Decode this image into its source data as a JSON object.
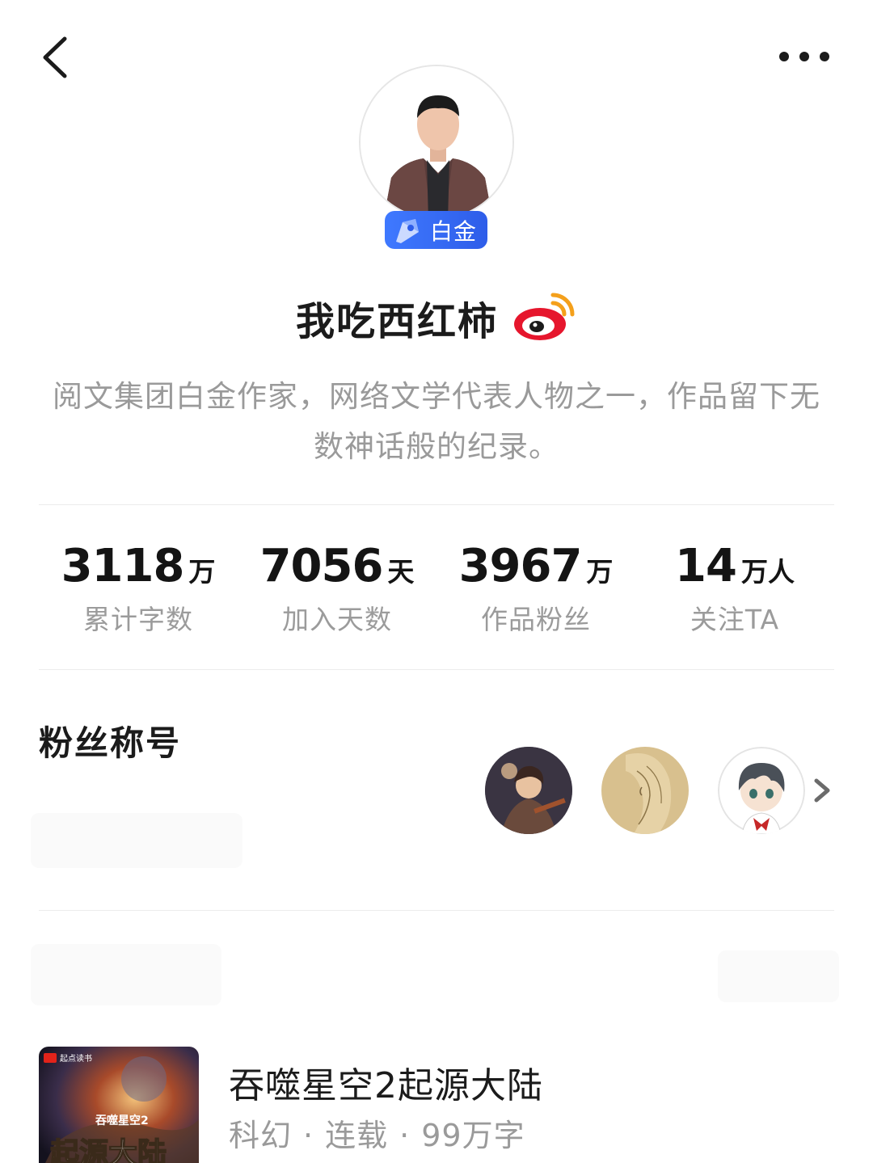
{
  "header": {
    "back_icon": "chevron-left-icon",
    "more_icon": "more-dots-icon"
  },
  "profile": {
    "badge_label": "白金",
    "badge_icon": "pen-nib-icon",
    "name": "我吃西红柿",
    "social_icon": "weibo-icon",
    "bio": "阅文集团白金作家，网络文学代表人物之一，作品留下无数神话般的纪录。"
  },
  "stats": [
    {
      "value": "3118",
      "unit": "万",
      "label": "累计字数"
    },
    {
      "value": "7056",
      "unit": "天",
      "label": "加入天数"
    },
    {
      "value": "3967",
      "unit": "万",
      "label": "作品粉丝"
    },
    {
      "value": "14",
      "unit": "万人",
      "label": "关注TA"
    }
  ],
  "fans": {
    "title": "粉丝称号",
    "arrow_icon": "chevron-right-icon"
  },
  "book": {
    "title": "吞噬星空2起源大陆",
    "genre": "科幻",
    "status": "连载",
    "words": "99万字",
    "separator": "·",
    "cover_badge": "起点读书",
    "cover_series": "吞噬星空2",
    "cover_title": "起源大陆"
  },
  "colors": {
    "badge_blue": "#2e5de9",
    "weibo_red": "#e6162d",
    "weibo_orange": "#f4a01b",
    "text_gray": "#9a9a9a"
  }
}
